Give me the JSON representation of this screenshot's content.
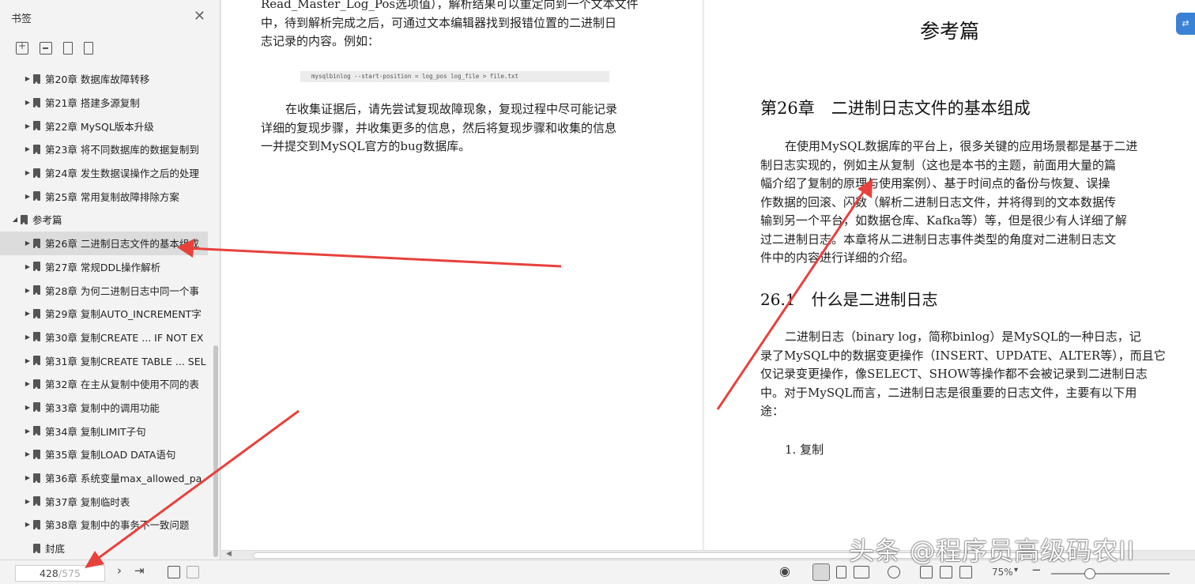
{
  "sidebar": {
    "title": "书签",
    "items": [
      {
        "label": "第20章 数据库故障转移",
        "level": 1,
        "expand": true
      },
      {
        "label": "第21章 搭建多源复制",
        "level": 1,
        "expand": true
      },
      {
        "label": "第22章 MySQL版本升级",
        "level": 1,
        "expand": true
      },
      {
        "label": "第23章 将不同数据库的数据复制到",
        "level": 1,
        "expand": true
      },
      {
        "label": "第24章 发生数据误操作之后的处理",
        "level": 1,
        "expand": true
      },
      {
        "label": "第25章 常用复制故障排除方案",
        "level": 1,
        "expand": true
      },
      {
        "label": "参考篇",
        "level": 0,
        "expand": true
      },
      {
        "label": "第26章 二进制日志文件的基本组成",
        "level": 1,
        "expand": true,
        "active": true
      },
      {
        "label": "第27章 常规DDL操作解析",
        "level": 1,
        "expand": true
      },
      {
        "label": "第28章 为何二进制日志中同一个事",
        "level": 1,
        "expand": true
      },
      {
        "label": "第29章 复制AUTO_INCREMENT字",
        "level": 1,
        "expand": true
      },
      {
        "label": "第30章 复制CREATE ... IF NOT EX",
        "level": 1,
        "expand": true
      },
      {
        "label": "第31章 复制CREATE TABLE ... SEL",
        "level": 1,
        "expand": true
      },
      {
        "label": "第32章 在主从复制中使用不同的表",
        "level": 1,
        "expand": true
      },
      {
        "label": "第33章 复制中的调用功能",
        "level": 1,
        "expand": true
      },
      {
        "label": "第34章 复制LIMIT子句",
        "level": 1,
        "expand": true
      },
      {
        "label": "第35章 复制LOAD DATA语句",
        "level": 1,
        "expand": true
      },
      {
        "label": "第36章 系统变量max_allowed_pa",
        "level": 1,
        "expand": true
      },
      {
        "label": "第37章 复制临时表",
        "level": 1,
        "expand": true
      },
      {
        "label": "第38章 复制中的事务不一致问题",
        "level": 1,
        "expand": true
      },
      {
        "label": "封底",
        "level": 1,
        "expand": false
      }
    ]
  },
  "left_page": {
    "para1": [
      "Read_Master_Log_Pos选项值），解析结果可以重定向到一个文本文件",
      "中，待到解析完成之后，可通过文本编辑器找到报错位置的二进制日",
      "志记录的内容。例如："
    ],
    "code": "mysqlbinlog --start-position = log_pos log_file > file.txt",
    "para2": [
      "在收集证据后，请先尝试复现故障现象，复现过程中尽可能记录",
      "详细的复现步骤，并收集更多的信息，然后将复现步骤和收集的信息",
      "一并提交到MySQL官方的bug数据库。"
    ]
  },
  "right_page": {
    "part_title": "参考篇",
    "chapter_title": "第26章　二进制日志文件的基本组成",
    "para1": [
      "在使用MySQL数据库的平台上，很多关键的应用场景都是基于二进",
      "制日志实现的，例如主从复制（这也是本书的主题，前面用大量的篇",
      "幅介绍了复制的原理与使用案例）、基于时间点的备份与恢复、误操",
      "作数据的回滚、闪数（解析二进制日志文件，并将得到的文本数据传",
      "输到另一个平台，如数据仓库、Kafka等）等，但是很少有人详细了解",
      "过二进制日志。本章将从二进制日志事件类型的角度对二进制日志文",
      "件中的内容进行详细的介绍。"
    ],
    "section_title": "26.1　什么是二进制日志",
    "para2": [
      "二进制日志（binary log，简称binlog）是MySQL的一种日志，记",
      "录了MySQL中的数据变更操作（INSERT、UPDATE、ALTER等），而且它",
      "仅记录变更操作，像SELECT、SHOW等操作都不会被记录到二进制日志",
      "中。对于MySQL而言，二进制日志是很重要的日志文件，主要有以下用",
      "途："
    ],
    "list_item": "1. 复制"
  },
  "status": {
    "current_page": "428",
    "total_pages": "/575",
    "zoom": "75%"
  },
  "watermark": "头条 @程序员高级码农II",
  "colors": {
    "arrow": "#e8413c",
    "sidebar_bg": "#f3f3f3",
    "active_item": "#dcdcdc"
  }
}
